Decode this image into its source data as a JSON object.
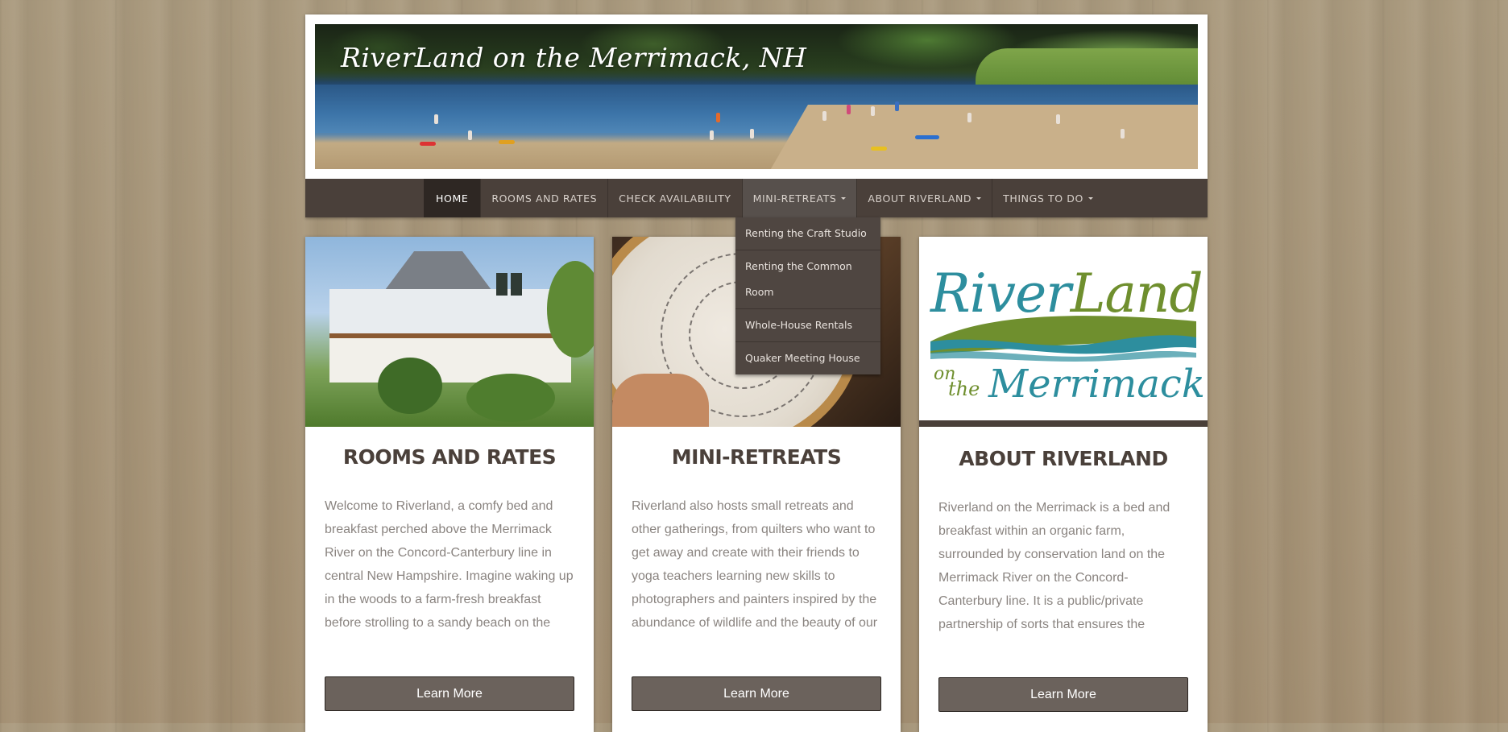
{
  "site": {
    "title": "RiverLand on the Merrimack, NH"
  },
  "nav": {
    "items": [
      {
        "label": "HOME"
      },
      {
        "label": "ROOMS AND RATES"
      },
      {
        "label": "CHECK AVAILABILITY"
      },
      {
        "label": "MINI-RETREATS"
      },
      {
        "label": "ABOUT RIVERLAND"
      },
      {
        "label": "THINGS TO DO"
      }
    ],
    "active": "HOME"
  },
  "dropdown": {
    "items": [
      "Renting the Craft Studio",
      "Renting the Common Room",
      "Whole-House Rentals",
      "Quaker Meeting House"
    ]
  },
  "cards": [
    {
      "heading": "ROOMS AND RATES",
      "text": "Welcome to Riverland, a comfy bed and breakfast perched above the Merrimack River on the Concord-Canterbury line in central New Hampshire.  Imagine waking up in the woods to a farm-fresh breakfast before strolling to a sandy beach on the river.  Perfect for birding, kayaking,…",
      "button": "Learn More",
      "image": "house-photo"
    },
    {
      "heading": "MINI-RETREATS",
      "text": "Riverland also hosts small retreats and other gatherings, from quilters who want to get away and create with their friends to yoga teachers learning new skills to photographers and painters inspired by the abundance of wildlife and the beauty of our surroundings. Riverland is…",
      "button": "Learn More",
      "image": "embroidery-photo"
    },
    {
      "heading": "ABOUT RIVERLAND",
      "text": "Riverland on the Merrimack is a bed and breakfast within an organic farm, surrounded by conservation land on the Merrimack River on the Concord-Canterbury line. It is a public/private partnership of sorts that ensures the protection of an important rare habitat, public access to…",
      "button": "Learn More",
      "image": "riverland-logo"
    }
  ],
  "logo": {
    "river": "River",
    "land": "Land",
    "on": "on",
    "the": "the",
    "merrimack": "Merrimack"
  },
  "colors": {
    "nav_bg": "#4a403a",
    "nav_active_bg": "#2e2723",
    "button_bg": "#6b625c",
    "heading": "#4a403a",
    "logo_teal": "#2d8e9e",
    "logo_green": "#6f8f2e"
  }
}
